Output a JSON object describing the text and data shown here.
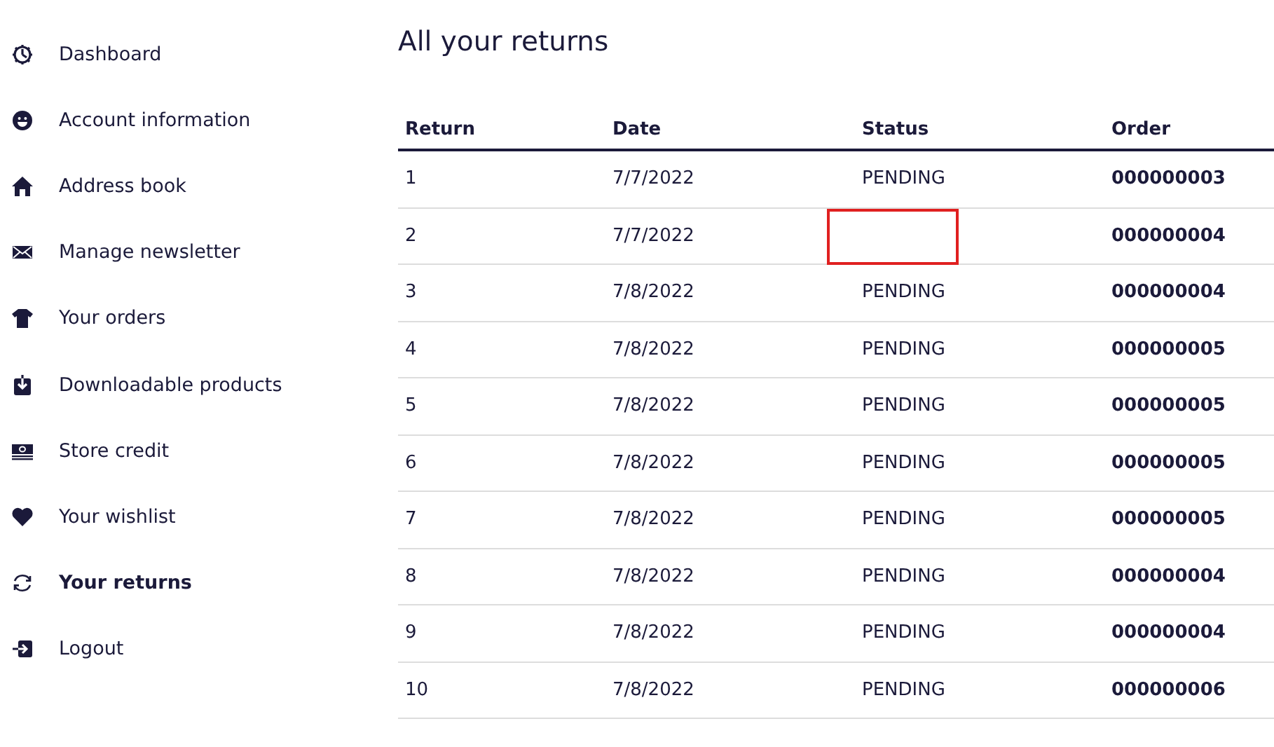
{
  "sidebar": {
    "items": [
      {
        "label": "Dashboard",
        "selected": false
      },
      {
        "label": "Account information",
        "selected": false
      },
      {
        "label": "Address book",
        "selected": false
      },
      {
        "label": "Manage newsletter",
        "selected": false
      },
      {
        "label": "Your orders",
        "selected": false
      },
      {
        "label": "Downloadable products",
        "selected": false
      },
      {
        "label": "Store credit",
        "selected": false
      },
      {
        "label": "Your wishlist",
        "selected": false
      },
      {
        "label": "Your returns",
        "selected": true
      },
      {
        "label": "Logout",
        "selected": false
      }
    ]
  },
  "title": "All your returns",
  "table": {
    "columns": [
      "Return",
      "Date",
      "Status",
      "Order"
    ],
    "rows": [
      {
        "return": "1",
        "date": "7/7/2022",
        "status": "PENDING",
        "order": "000000003",
        "flagged": false
      },
      {
        "return": "2",
        "date": "7/7/2022",
        "order": "000000004",
        "flagged": true
      },
      {
        "return": "3",
        "date": "7/8/2022",
        "status": "PENDING",
        "order": "000000004",
        "flagged": false
      },
      {
        "return": "4",
        "date": "7/8/2022",
        "status": "PENDING",
        "order": "000000005",
        "flagged": false
      },
      {
        "return": "5",
        "date": "7/8/2022",
        "status": "PENDING",
        "order": "000000005",
        "flagged": false
      },
      {
        "return": "6",
        "date": "7/8/2022",
        "status": "PENDING",
        "order": "000000005",
        "flagged": false
      },
      {
        "return": "7",
        "date": "7/8/2022",
        "status": "PENDING",
        "order": "000000005",
        "flagged": false
      },
      {
        "return": "8",
        "date": "7/8/2022",
        "status": "PENDING",
        "order": "000000004",
        "flagged": false
      },
      {
        "return": "9",
        "date": "7/8/2022",
        "status": "PENDING",
        "order": "000000004",
        "flagged": false
      },
      {
        "return": "10",
        "date": "7/8/2022",
        "status": "PENDING",
        "order": "000000006",
        "flagged": false
      }
    ]
  }
}
